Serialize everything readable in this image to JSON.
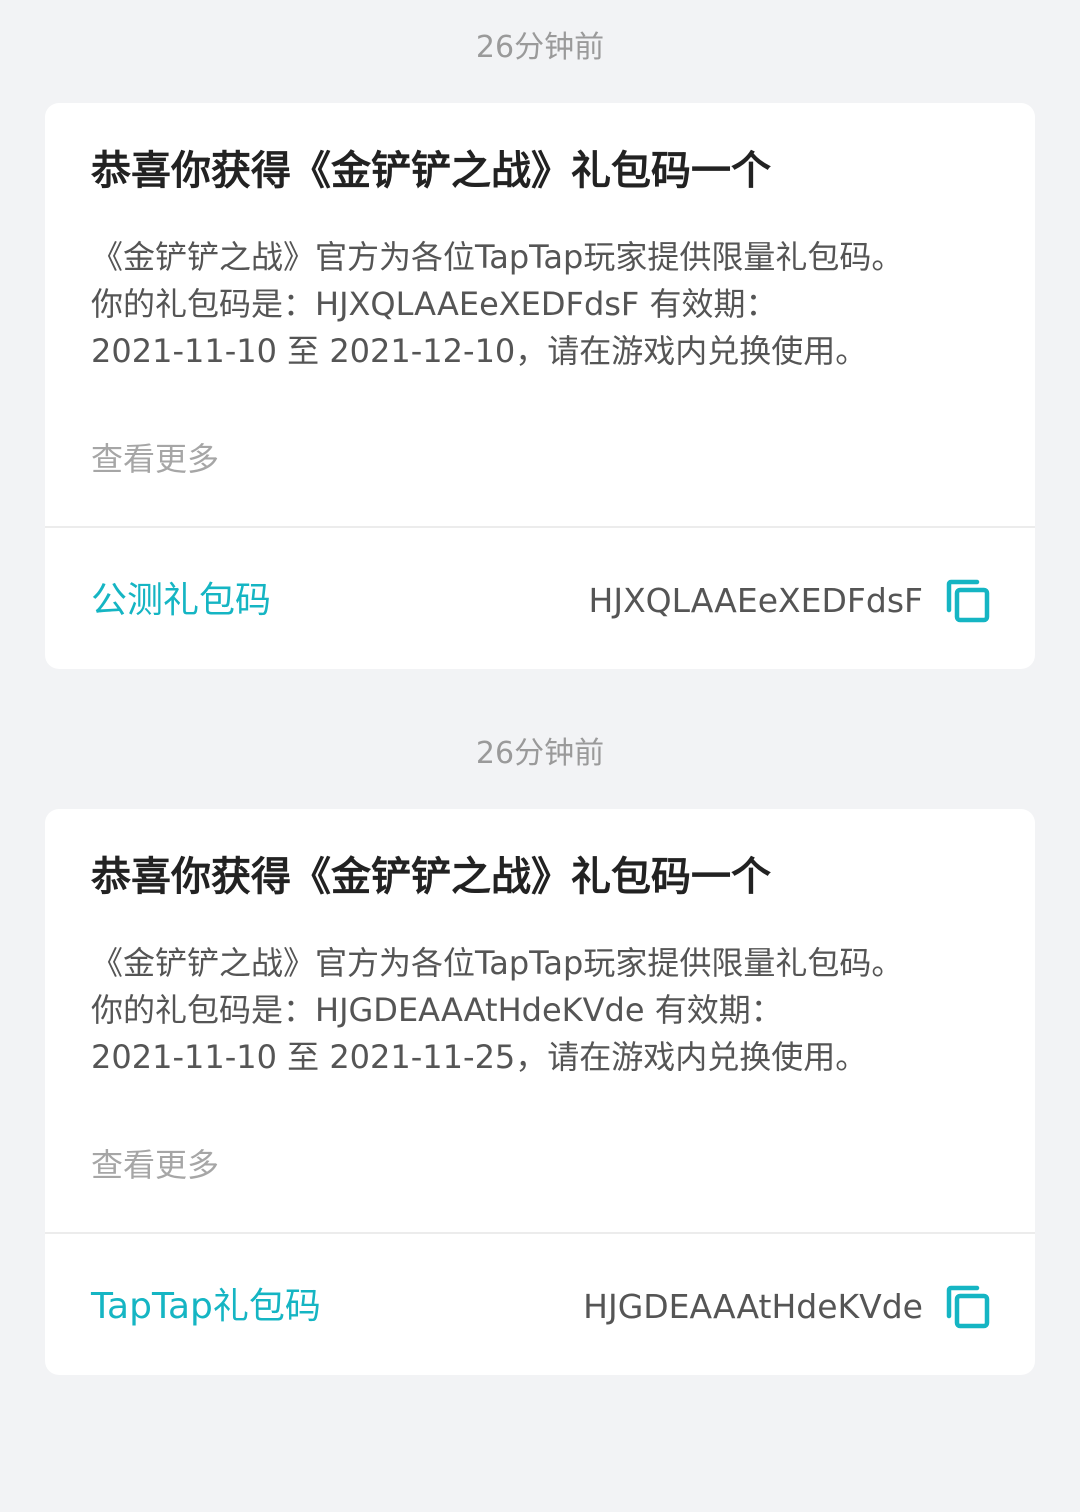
{
  "messages": [
    {
      "time": "26分钟前",
      "title": "恭喜你获得《金铲铲之战》礼包码一个",
      "body_lines": [
        "《金铲铲之战》官方为各位TapTap玩家提供限量礼包码。",
        "你的礼包码是：HJXQLAAEeXEDFdsF 有效期：",
        "2021-11-10 至 2021-12-10，请在游戏内兑换使用。"
      ],
      "see_more": "查看更多",
      "code_type": "公测礼包码",
      "code": "HJXQLAAEeXEDFdsF",
      "copy_icon": "copy-icon"
    },
    {
      "time": "26分钟前",
      "title": "恭喜你获得《金铲铲之战》礼包码一个",
      "body_lines": [
        "《金铲铲之战》官方为各位TapTap玩家提供限量礼包码。",
        "你的礼包码是：HJGDEAAAtHdeKVde 有效期：",
        "2021-11-10 至 2021-11-25，请在游戏内兑换使用。"
      ],
      "see_more": "查看更多",
      "code_type": "TapTap礼包码",
      "code": "HJGDEAAAtHdeKVde",
      "copy_icon": "copy-icon"
    }
  ],
  "colors": {
    "accent": "#15b5c3",
    "background": "#f2f3f5",
    "card": "#ffffff",
    "title_text": "#222222",
    "body_text": "#555555",
    "muted_text": "#9a9a9a"
  }
}
